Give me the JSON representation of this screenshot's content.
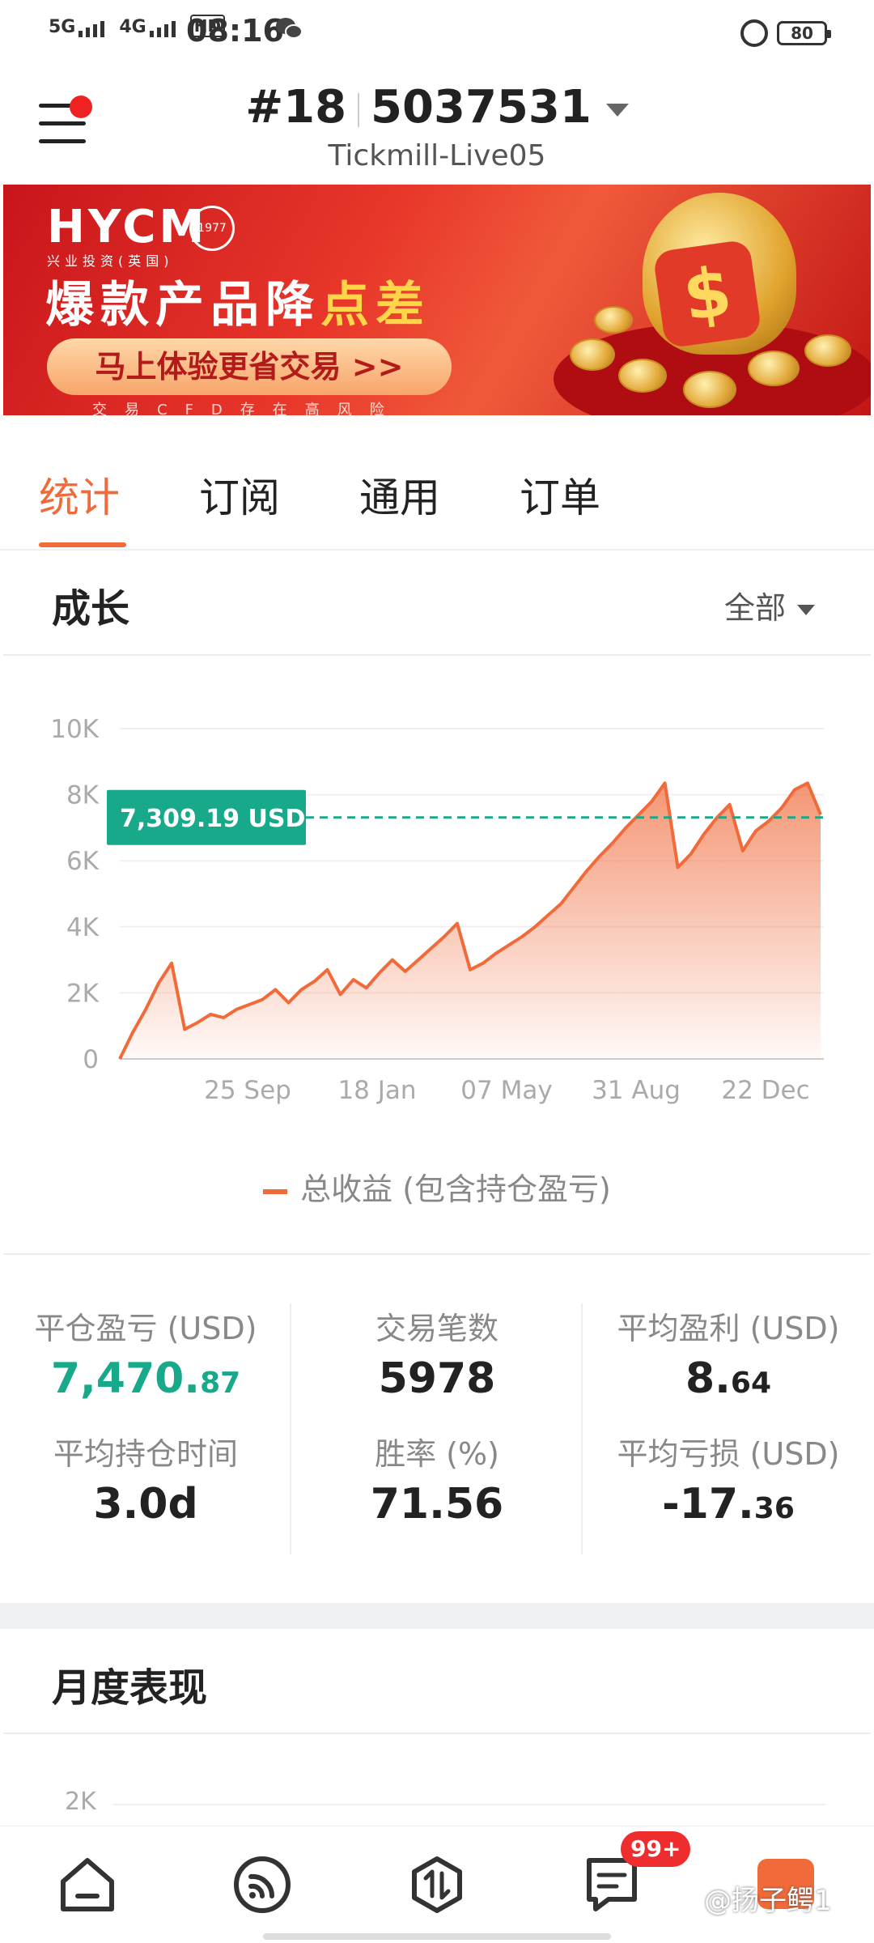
{
  "status_bar": {
    "net1": "5G",
    "net2": "4G",
    "hd": "HD",
    "time": "08:16",
    "battery": "80"
  },
  "header": {
    "account_prefix": "#18",
    "account_number": "5037531",
    "server": "Tickmill-Live05"
  },
  "banner": {
    "brand": "HYCM",
    "brand_sub": "兴业投资(英国)",
    "badge": "1977",
    "headline_main": "爆款产品降",
    "headline_highlight": "点差",
    "cta": "马上体验更省交易 >>",
    "risk": "交易CFD存在高风险"
  },
  "tabs": [
    "统计",
    "订阅",
    "通用",
    "订单"
  ],
  "growth": {
    "title": "成长",
    "filter": "全部",
    "legend": "总收益 (包含持仓盈亏)"
  },
  "chart_data": {
    "type": "area",
    "x_ticks": [
      "25 Sep",
      "18 Jan",
      "07 May",
      "31 Aug",
      "22 Dec"
    ],
    "y_ticks": [
      "10K",
      "8K",
      "6K",
      "4K",
      "2K",
      "0"
    ],
    "ylim": [
      0,
      10000
    ],
    "series": [
      {
        "name": "总收益 (包含持仓盈亏)",
        "color": "#f06a3a",
        "values": [
          0,
          800,
          1500,
          2300,
          2900,
          900,
          1100,
          1350,
          1250,
          1500,
          1650,
          1800,
          2100,
          1700,
          2100,
          2350,
          2700,
          1950,
          2400,
          2150,
          2600,
          3000,
          2650,
          3000,
          3350,
          3700,
          4100,
          2700,
          2900,
          3200,
          3450,
          3700,
          4000,
          4350,
          4700,
          5200,
          5700,
          6150,
          6550,
          7000,
          7400,
          7800,
          8350,
          5800,
          6200,
          6800,
          7300,
          7700,
          6300,
          6900,
          7200,
          7600,
          8150,
          8350,
          7400
        ]
      }
    ],
    "marker": {
      "value": 7309.19,
      "label": "7,309.19 USD",
      "color": "#17a98a"
    }
  },
  "stats": [
    {
      "label": "平仓盈亏 (USD)",
      "value_int": "7,470.",
      "value_dec": "87"
    },
    {
      "label": "交易笔数",
      "value_int": "5978",
      "value_dec": ""
    },
    {
      "label": "平均盈利 (USD)",
      "value_int": "8.",
      "value_dec": "64"
    },
    {
      "label": "平均持仓时间",
      "value_int": "3.0d",
      "value_dec": ""
    },
    {
      "label": "胜率 (%)",
      "value_int": "71.56",
      "value_dec": ""
    },
    {
      "label": "平均亏损 (USD)",
      "value_int": "-17.",
      "value_dec": "36"
    }
  ],
  "monthly": {
    "title": "月度表现",
    "y_tick": "2K"
  },
  "bottom_nav": {
    "badge": "99+",
    "watermark": "@扬子鳄1"
  }
}
